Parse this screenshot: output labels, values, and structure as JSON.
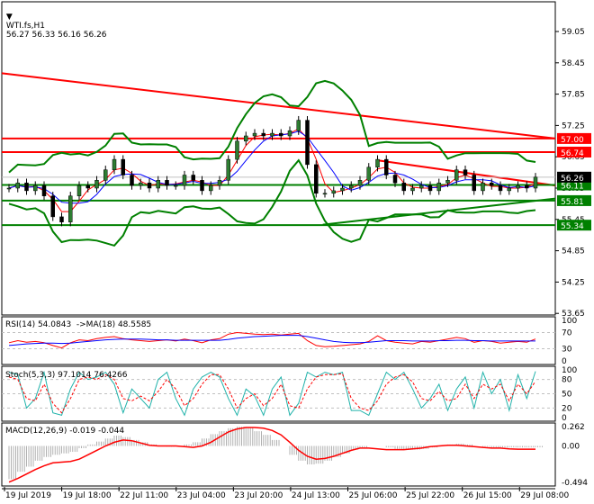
{
  "header": {
    "symbol": "WTI.fs,H1",
    "ohlc": "56.27 56.33 56.16 56.26"
  },
  "colors": {
    "up": "#2e7d32",
    "red": "#ff0000",
    "green": "#008000",
    "blue": "#0000ff",
    "teal": "#20b2aa",
    "black": "#000000"
  },
  "chart_data": [
    {
      "type": "candlestick",
      "title": "WTI.fs,H1",
      "ylim": [
        53.65,
        59.35
      ],
      "yticks": [
        "59.05",
        "58.45",
        "57.85",
        "57.25",
        "56.65",
        "56.05",
        "55.45",
        "54.85",
        "54.25",
        "53.65"
      ],
      "closes": [
        56.05,
        56.15,
        56.0,
        56.1,
        55.9,
        55.5,
        55.4,
        55.9,
        56.1,
        56.05,
        56.2,
        56.4,
        56.6,
        56.3,
        56.1,
        56.15,
        56.05,
        56.2,
        56.1,
        56.1,
        56.3,
        56.2,
        56.0,
        56.1,
        56.2,
        56.6,
        56.95,
        57.05,
        57.1,
        57.05,
        57.1,
        57.05,
        57.15,
        57.35,
        56.5,
        55.95,
        55.95,
        56.0,
        56.05,
        56.1,
        56.2,
        56.45,
        56.6,
        56.3,
        56.15,
        56.0,
        56.05,
        56.1,
        56.0,
        56.15,
        56.2,
        56.4,
        56.3,
        56.0,
        56.15,
        56.1,
        56.0,
        56.05,
        56.1,
        56.05,
        56.26
      ],
      "levels": [
        {
          "value": "57.00",
          "color": "#ff0000"
        },
        {
          "value": "56.74",
          "color": "#ff0000"
        },
        {
          "value": "56.11",
          "color": "#008000"
        },
        {
          "value": "55.81",
          "color": "#008000"
        },
        {
          "value": "55.34",
          "color": "#008000"
        }
      ],
      "current_price": "56.26",
      "trendlines": [
        {
          "color": "#ff0000",
          "from": [
            0,
            58.25
          ],
          "to": [
            1,
            57.0
          ]
        },
        {
          "color": "#ff0000",
          "from": [
            0.68,
            56.58
          ],
          "to": [
            1,
            56.1
          ]
        },
        {
          "color": "#008000",
          "from": [
            0.58,
            55.35
          ],
          "to": [
            1,
            55.85
          ]
        }
      ]
    },
    {
      "type": "line",
      "title": "RSI(14) 54.0843  ->MA(18) 48.5585",
      "ylim": [
        0,
        100
      ],
      "yticks": [
        "100",
        "70",
        "30",
        "0"
      ],
      "series": [
        {
          "name": "RSI",
          "color": "#ff0000",
          "values": [
            45,
            50,
            46,
            48,
            45,
            38,
            32,
            45,
            52,
            50,
            55,
            58,
            60,
            55,
            52,
            50,
            48,
            50,
            52,
            49,
            54,
            50,
            45,
            52,
            55,
            66,
            70,
            68,
            66,
            65,
            66,
            64,
            66,
            68,
            50,
            38,
            35,
            36,
            38,
            40,
            42,
            48,
            62,
            50,
            46,
            44,
            42,
            48,
            46,
            50,
            54,
            58,
            55,
            46,
            50,
            48,
            44,
            46,
            48,
            46,
            54
          ]
        },
        {
          "name": "MA",
          "color": "#0000ff",
          "values": [
            38,
            40,
            42,
            43,
            44,
            44,
            43,
            44,
            46,
            48,
            50,
            52,
            53,
            54,
            54,
            54,
            53,
            52,
            52,
            51,
            51,
            51,
            51,
            51,
            51,
            53,
            56,
            58,
            60,
            61,
            62,
            63,
            63,
            63,
            60,
            56,
            52,
            48,
            46,
            45,
            45,
            46,
            48,
            50,
            50,
            50,
            49,
            49,
            49,
            50,
            50,
            51,
            51,
            50,
            50,
            49,
            49,
            49,
            49,
            49,
            49
          ]
        }
      ]
    },
    {
      "type": "line",
      "title": "Stoch(5,3,3) 97.1014 76.4266",
      "ylim": [
        0,
        100
      ],
      "yticks": [
        "100",
        "80",
        "50",
        "20",
        "0"
      ],
      "series": [
        {
          "name": "%K",
          "color": "#20b2aa",
          "values": [
            95,
            90,
            20,
            40,
            95,
            10,
            5,
            60,
            95,
            80,
            85,
            95,
            70,
            10,
            60,
            40,
            20,
            80,
            95,
            40,
            5,
            60,
            85,
            95,
            85,
            40,
            5,
            60,
            45,
            5,
            60,
            85,
            5,
            30,
            95,
            85,
            95,
            90,
            95,
            15,
            15,
            5,
            50,
            95,
            80,
            95,
            60,
            20,
            40,
            70,
            15,
            60,
            85,
            20,
            95,
            50,
            80,
            15,
            90,
            40,
            97
          ]
        },
        {
          "name": "%D",
          "color": "#ff0000",
          "values": [
            85,
            80,
            40,
            35,
            70,
            30,
            10,
            40,
            80,
            85,
            80,
            90,
            80,
            40,
            35,
            45,
            35,
            55,
            80,
            60,
            25,
            40,
            70,
            90,
            90,
            60,
            20,
            40,
            50,
            25,
            40,
            70,
            25,
            20,
            60,
            85,
            90,
            90,
            92,
            40,
            20,
            15,
            35,
            70,
            85,
            90,
            75,
            40,
            35,
            55,
            35,
            40,
            70,
            40,
            70,
            60,
            70,
            35,
            70,
            50,
            76
          ]
        }
      ]
    },
    {
      "type": "bar+line",
      "title": "MACD(12,26,9) -0.019 -0.044",
      "ylim": [
        -0.494,
        0.262
      ],
      "yticks": [
        "0.262",
        "0.00",
        "-0.494"
      ],
      "histogram": [
        -0.45,
        -0.35,
        -0.28,
        -0.2,
        -0.15,
        -0.12,
        -0.1,
        -0.08,
        -0.03,
        0.02,
        0.06,
        0.1,
        0.14,
        0.12,
        0.08,
        0.05,
        0.02,
        0.0,
        -0.01,
        0.0,
        0.02,
        0.05,
        0.1,
        0.16,
        0.2,
        0.24,
        0.26,
        0.25,
        0.2,
        0.15,
        0.08,
        0.0,
        -0.12,
        -0.2,
        -0.25,
        -0.24,
        -0.2,
        -0.15,
        -0.1,
        -0.05,
        -0.02,
        0.0,
        0.0,
        -0.02,
        -0.04,
        -0.05,
        -0.05,
        -0.04,
        -0.02,
        0.0,
        0.02,
        0.03,
        0.02,
        0.0,
        -0.01,
        -0.02,
        -0.02,
        -0.02,
        -0.02,
        -0.02,
        -0.019
      ],
      "signal": [
        -0.49,
        -0.44,
        -0.38,
        -0.32,
        -0.27,
        -0.23,
        -0.22,
        -0.21,
        -0.18,
        -0.12,
        -0.06,
        0.0,
        0.05,
        0.08,
        0.07,
        0.04,
        0.01,
        0.0,
        0.0,
        0.0,
        -0.01,
        -0.02,
        0.0,
        0.05,
        0.12,
        0.19,
        0.23,
        0.25,
        0.25,
        0.24,
        0.21,
        0.15,
        0.05,
        -0.06,
        -0.14,
        -0.18,
        -0.17,
        -0.14,
        -0.1,
        -0.06,
        -0.03,
        -0.03,
        -0.04,
        -0.05,
        -0.05,
        -0.05,
        -0.04,
        -0.03,
        -0.01,
        0.0,
        0.01,
        0.01,
        0.0,
        -0.01,
        -0.02,
        -0.03,
        -0.03,
        -0.04,
        -0.044,
        -0.044,
        -0.044
      ]
    }
  ],
  "time_axis": [
    "19 Jul 2019",
    "19 Jul 18:00",
    "22 Jul 11:00",
    "23 Jul 04:00",
    "23 Jul 20:00",
    "24 Jul 13:00",
    "25 Jul 06:00",
    "25 Jul 22:00",
    "26 Jul 15:00",
    "29 Jul 08:00"
  ]
}
